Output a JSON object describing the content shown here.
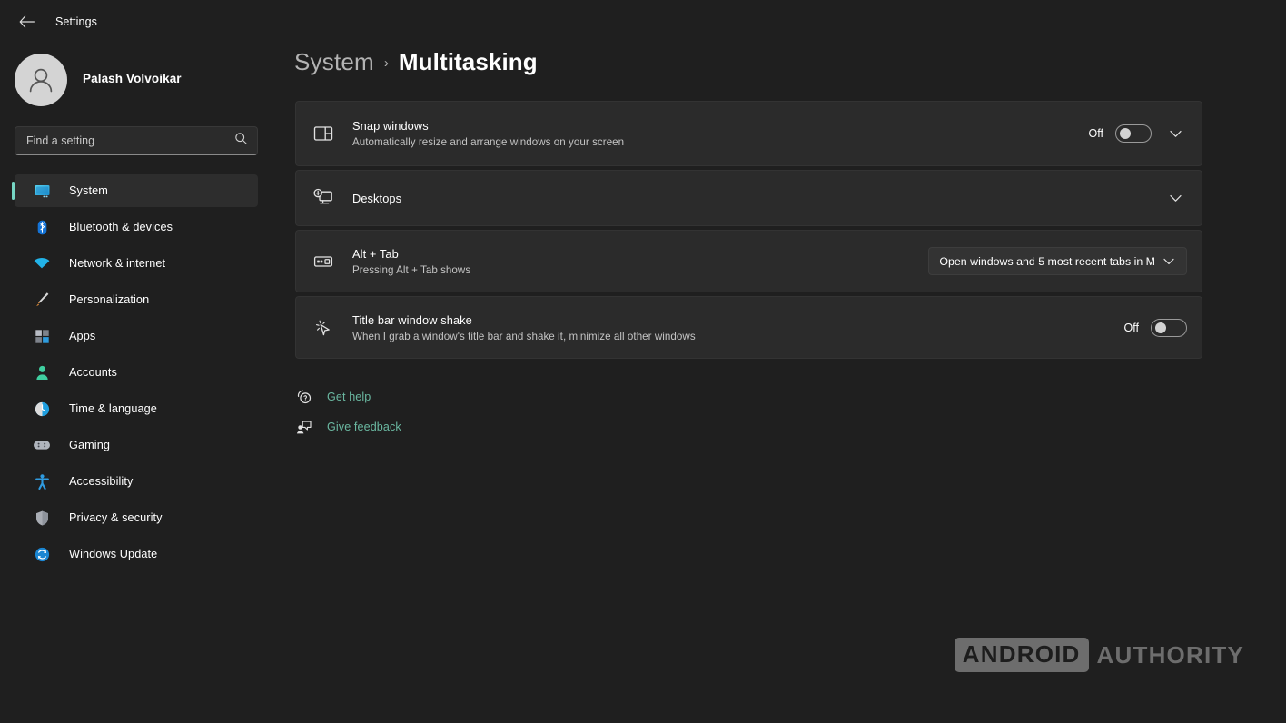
{
  "window": {
    "title": "Settings",
    "back_icon": "back-arrow-icon"
  },
  "sidebar": {
    "account": {
      "name": "Palash Volvoikar",
      "email": "",
      "avatar_icon": "user-avatar-icon"
    },
    "search": {
      "placeholder": "Find a setting",
      "value": "",
      "icon": "search-icon"
    },
    "items": [
      {
        "label": "System",
        "icon": "monitor-icon",
        "selected": true
      },
      {
        "label": "Bluetooth & devices",
        "icon": "bluetooth-icon",
        "selected": false
      },
      {
        "label": "Network & internet",
        "icon": "wifi-icon",
        "selected": false
      },
      {
        "label": "Personalization",
        "icon": "paintbrush-icon",
        "selected": false
      },
      {
        "label": "Apps",
        "icon": "apps-grid-icon",
        "selected": false
      },
      {
        "label": "Accounts",
        "icon": "person-icon",
        "selected": false
      },
      {
        "label": "Time & language",
        "icon": "clock-icon",
        "selected": false
      },
      {
        "label": "Gaming",
        "icon": "gamepad-icon",
        "selected": false
      },
      {
        "label": "Accessibility",
        "icon": "accessibility-icon",
        "selected": false
      },
      {
        "label": "Privacy & security",
        "icon": "shield-icon",
        "selected": false
      },
      {
        "label": "Windows Update",
        "icon": "update-refresh-icon",
        "selected": false
      }
    ]
  },
  "main": {
    "breadcrumb": {
      "parent": "System",
      "separator": "›",
      "current": "Multitasking"
    },
    "settings": [
      {
        "title": "Snap windows",
        "subtitle": "Automatically resize and arrange windows on your screen",
        "icon": "snap-layout-icon",
        "control": "toggle",
        "toggle_label": "Off",
        "toggle_on": false,
        "expand_icon": "chevron-down-icon"
      },
      {
        "title": "Desktops",
        "subtitle": "",
        "icon": "virtual-desktop-icon",
        "control": "expand",
        "expand_icon": "chevron-down-icon"
      },
      {
        "title": "Alt + Tab",
        "subtitle": "Pressing Alt + Tab shows",
        "icon": "alt-tab-icon",
        "control": "dropdown",
        "dropdown_value": "Open windows and 5 most recent tabs in M",
        "expand_icon": "chevron-down-icon"
      },
      {
        "title": "Title bar window shake",
        "subtitle": "When I grab a window's title bar and shake it, minimize all other windows",
        "icon": "cursor-shake-icon",
        "control": "toggle",
        "toggle_label": "Off",
        "toggle_on": false
      }
    ],
    "links": [
      {
        "label": "Get help",
        "icon": "help-question-icon"
      },
      {
        "label": "Give feedback",
        "icon": "feedback-icon"
      }
    ]
  },
  "watermark": {
    "boxed_word": "ANDROID",
    "plain_word": "AUTHORITY"
  },
  "colors": {
    "accent": "#76d6c4",
    "link": "#6ab7a0",
    "card_bg": "#2b2b2b",
    "page_bg": "#1f1f1f"
  }
}
